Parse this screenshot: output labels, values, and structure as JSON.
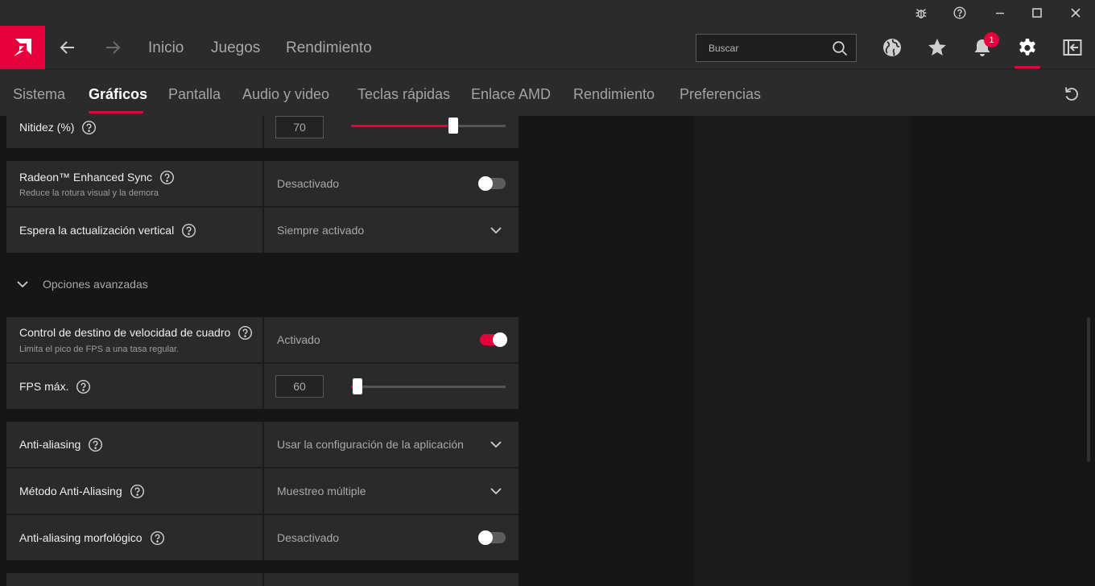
{
  "colors": {
    "accent": "#e5003c",
    "topbar": "#2b2b2b",
    "card": "#2a2a2a",
    "background": "#161616"
  },
  "titlebar": {
    "icons": [
      "bug-icon",
      "help-icon",
      "minimize-icon",
      "maximize-icon",
      "close-icon"
    ]
  },
  "topnav": {
    "links": [
      "Inicio",
      "Juegos",
      "Rendimiento"
    ],
    "search_placeholder": "Buscar",
    "notifications_count": "1",
    "icons": [
      "globe-icon",
      "star-icon",
      "bell-icon",
      "gear-icon",
      "sidebar-toggle-icon"
    ]
  },
  "subnav": {
    "tabs": [
      "Sistema",
      "Gráficos",
      "Pantalla",
      "Audio y video",
      "Teclas rápidas",
      "Enlace AMD",
      "Rendimiento",
      "Preferencias"
    ],
    "active_tab": "Gráficos"
  },
  "settings": {
    "sharpness": {
      "label": "Nitidez (%)",
      "value": "70",
      "fraction": 0.66
    },
    "enhanced_sync": {
      "label": "Radeon™ Enhanced Sync",
      "description": "Reduce la rotura visual y la demora",
      "state": "Desactivado",
      "on": false
    },
    "vsync": {
      "label": "Espera la actualización vertical",
      "value": "Siempre activado"
    },
    "advanced_label": "Opciones avanzadas",
    "frtc": {
      "label": "Control de destino de velocidad de cuadro",
      "description": "Limita el pico de FPS a una tasa regular.",
      "state": "Activado",
      "on": true
    },
    "fps_max": {
      "label": "FPS máx.",
      "value": "60",
      "fraction": 0.04
    },
    "anti_aliasing": {
      "label": "Anti-aliasing",
      "value": "Usar la configuración de la aplicación"
    },
    "aa_method": {
      "label": "Método Anti-Aliasing",
      "value": "Muestreo múltiple"
    },
    "morph_aa": {
      "label": "Anti-aliasing morfológico",
      "state": "Desactivado",
      "on": false
    }
  }
}
